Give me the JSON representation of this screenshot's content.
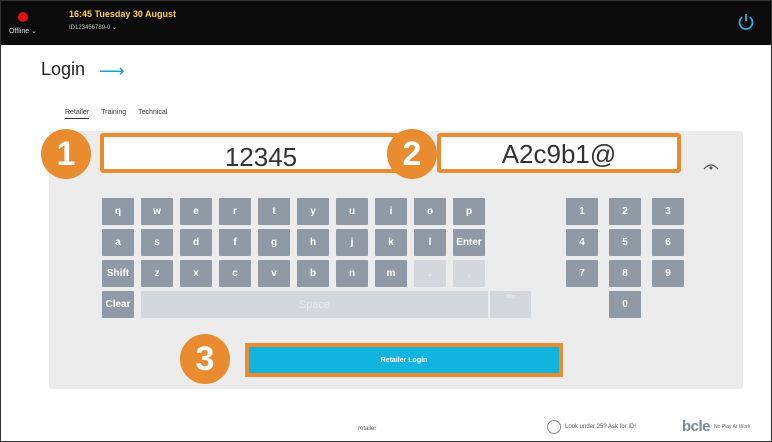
{
  "topbar": {
    "status": "Offline",
    "datetime": "16:45 Tuesday 30 August",
    "terminal_id": "ID123456789-0"
  },
  "page": {
    "title": "Login"
  },
  "tabs": [
    {
      "label": "Retailer",
      "active": true
    },
    {
      "label": "Training",
      "active": false
    },
    {
      "label": "Technical",
      "active": false
    }
  ],
  "fields": {
    "retailer_id": "12345",
    "password": "A2c9b1@"
  },
  "annotations": [
    "1",
    "2",
    "3"
  ],
  "keyboard": {
    "row1": [
      "q",
      "w",
      "e",
      "r",
      "t",
      "y",
      "u",
      "i",
      "o",
      "p"
    ],
    "row2": [
      "a",
      "s",
      "d",
      "f",
      "g",
      "h",
      "j",
      "k",
      "l",
      "Enter"
    ],
    "row3": [
      "Shift",
      "z",
      "x",
      "c",
      "v",
      "b",
      "n",
      "m",
      ".",
      ","
    ],
    "clear_label": "Clear",
    "space_label": "Space",
    "space_right_label": "Bkg",
    "numpad": [
      "1",
      "2",
      "3",
      "4",
      "5",
      "6",
      "7",
      "8",
      "9",
      "0"
    ]
  },
  "login_button": "Retailer Login",
  "footer": {
    "center": "retailer",
    "age_text": "Look under 25? Ask for ID!",
    "brand": "bcle",
    "tagline": "No Play At Work"
  },
  "colors": {
    "accent_orange": "#e98c2f",
    "button_blue": "#11b3df",
    "key_gray": "#8f9aa6",
    "status_red": "#dd1111"
  }
}
